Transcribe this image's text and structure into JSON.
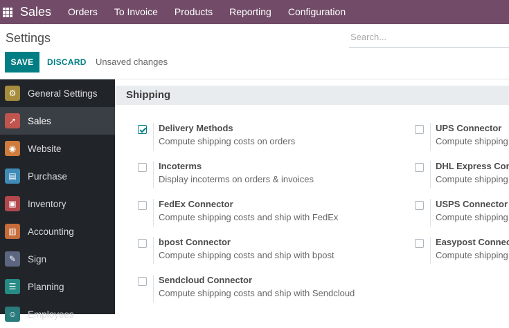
{
  "topbar": {
    "brand": "Sales",
    "menu": [
      "Orders",
      "To Invoice",
      "Products",
      "Reporting",
      "Configuration"
    ]
  },
  "control_panel": {
    "title": "Settings",
    "search_placeholder": "Search...",
    "save_label": "SAVE",
    "discard_label": "DISCARD",
    "status": "Unsaved changes"
  },
  "sidebar": {
    "items": [
      {
        "label": "General Settings",
        "icon": "gear-icon",
        "color": "#a58d3d"
      },
      {
        "label": "Sales",
        "icon": "chart-icon",
        "color": "#c0544e",
        "active": true
      },
      {
        "label": "Website",
        "icon": "globe-icon",
        "color": "#cf7c3d"
      },
      {
        "label": "Purchase",
        "icon": "card-icon",
        "color": "#3f8bb6"
      },
      {
        "label": "Inventory",
        "icon": "box-icon",
        "color": "#b2484c"
      },
      {
        "label": "Accounting",
        "icon": "ledger-icon",
        "color": "#c66d3b"
      },
      {
        "label": "Sign",
        "icon": "sign-icon",
        "color": "#5d6680"
      },
      {
        "label": "Planning",
        "icon": "planning-icon",
        "color": "#278b85"
      },
      {
        "label": "Employees",
        "icon": "people-icon",
        "color": "#2a7b7b"
      }
    ]
  },
  "shipping": {
    "title": "Shipping",
    "left": [
      {
        "title": "Delivery Methods",
        "desc": "Compute shipping costs on orders",
        "checked": true
      },
      {
        "title": "Incoterms",
        "desc": "Display incoterms on orders & invoices",
        "checked": false
      },
      {
        "title": "FedEx Connector",
        "desc": "Compute shipping costs and ship with FedEx",
        "checked": false
      },
      {
        "title": "bpost Connector",
        "desc": "Compute shipping costs and ship with bpost",
        "checked": false
      },
      {
        "title": "Sendcloud Connector",
        "desc": "Compute shipping costs and ship with Sendcloud",
        "checked": false
      }
    ],
    "right": [
      {
        "title": "UPS Connector",
        "desc": "Compute shipping costs and ship with UPS",
        "checked": false
      },
      {
        "title": "DHL Express Connector",
        "desc": "Compute shipping costs and ship with DHL",
        "checked": false
      },
      {
        "title": "USPS Connector",
        "desc": "Compute shipping costs and ship with USPS",
        "checked": false
      },
      {
        "title": "Easypost Connector",
        "desc": "Compute shipping costs and ship with Easypost",
        "checked": false
      }
    ]
  }
}
